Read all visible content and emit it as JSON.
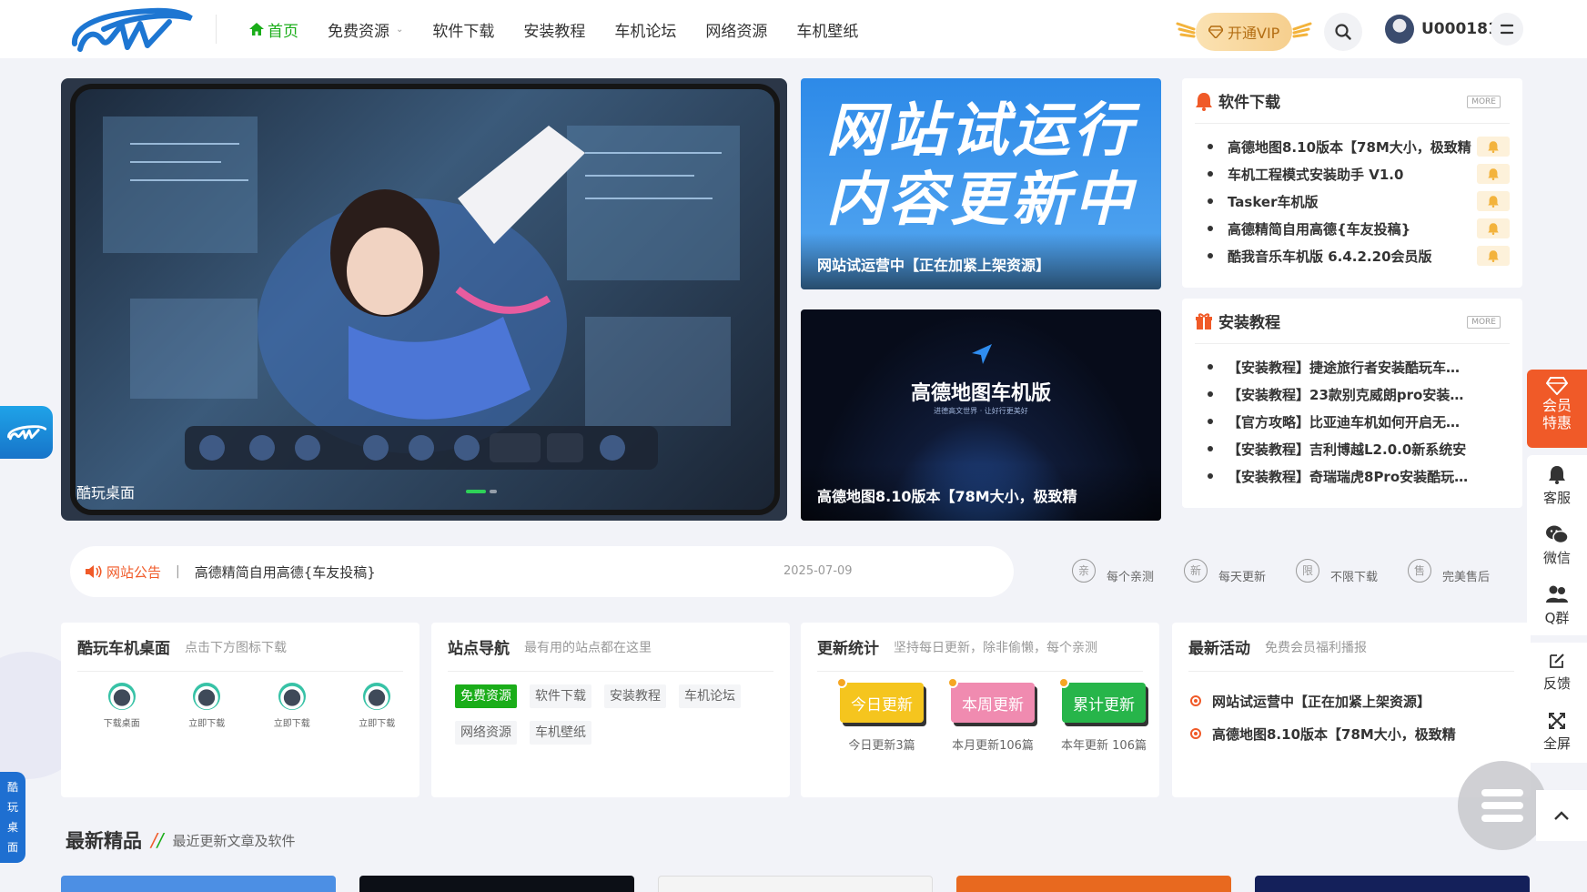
{
  "header": {
    "nav": [
      {
        "label": "首页",
        "active": true
      },
      {
        "label": "免费资源",
        "dropdown": true
      },
      {
        "label": "软件下载"
      },
      {
        "label": "安装教程"
      },
      {
        "label": "车机论坛"
      },
      {
        "label": "网络资源"
      },
      {
        "label": "车机壁纸"
      }
    ],
    "vip_label": "开通VIP",
    "username": "U000181"
  },
  "hero": {
    "caption": "酷玩桌面"
  },
  "cards": [
    {
      "big_lines": [
        "网站试运行",
        "内容更新中"
      ],
      "caption": "网站试运营中【正在加紧上架资源】"
    },
    {
      "title": "高德地图车机版",
      "subtitle": "进德高文世界 · 让好行更美好",
      "caption": "高德地图8.10版本【78M大小，极致精"
    }
  ],
  "software": {
    "title": "软件下载",
    "more": "MORE",
    "items": [
      "高德地图8.10版本【78M大小，极致精",
      "车机工程模式安装助手 V1.0",
      "Tasker车机版",
      "高德精简自用高德{车友投稿}",
      "酷我音乐车机版 6.4.2.20会员版"
    ]
  },
  "tutorials": {
    "title": "安装教程",
    "more": "MORE",
    "items": [
      "【安装教程】捷途旅行者安装酷玩车…",
      "【安装教程】23款别克威朗pro安装…",
      "【官方攻略】比亚迪车机如何开启无…",
      "【安装教程】吉利博越L2.0.0新系统安",
      "【安装教程】奇瑞瑞虎8Pro安装酷玩…"
    ]
  },
  "notice": {
    "label": "网站公告",
    "sep": "|",
    "message": "高德精简自用高德{车友投稿}",
    "date": "2025-07-09"
  },
  "features": [
    {
      "badge": "亲",
      "text": "每个亲测"
    },
    {
      "badge": "新",
      "text": "每天更新"
    },
    {
      "badge": "限",
      "text": "不限下载"
    },
    {
      "badge": "售",
      "text": "完美售后"
    }
  ],
  "desktop_card": {
    "title": "酷玩车机桌面",
    "hint": "点击下方图标下载",
    "items": [
      "下载桌面",
      "立即下载",
      "立即下载",
      "立即下载"
    ]
  },
  "nav_card": {
    "title": "站点导航",
    "hint": "最有用的站点都在这里",
    "tags": [
      "免费资源",
      "软件下载",
      "安装教程",
      "车机论坛",
      "网络资源",
      "车机壁纸"
    ]
  },
  "stats_card": {
    "title": "更新统计",
    "hint": "坚持每日更新，除非偷懒，每个亲测",
    "items": [
      {
        "label": "今日更新",
        "caption": "今日更新3篇",
        "color": "#f5c51e"
      },
      {
        "label": "本周更新",
        "caption": "本月更新106篇",
        "color": "#f08bb0"
      },
      {
        "label": "累计更新",
        "caption": "本年更新 106篇",
        "color": "#27b54a"
      }
    ]
  },
  "activity_card": {
    "title": "最新活动",
    "hint": "免费会员福利播报",
    "items": [
      "网站试运营中【正在加紧上架资源】",
      "高德地图8.10版本【78M大小，极致精"
    ]
  },
  "section": {
    "title": "最新精品",
    "slash": "//",
    "subtitle": "最近更新文章及软件"
  },
  "right_bar": {
    "vip": [
      "会员",
      "特惠"
    ],
    "group1": [
      "客服",
      "微信",
      "Q群"
    ],
    "group2": [
      "反馈",
      "全屏"
    ]
  },
  "left_vertical": [
    "酷",
    "玩",
    "桌",
    "面"
  ],
  "colors": {
    "accent_green": "#1aad19",
    "accent_orange": "#f05a28",
    "vip_gold": "#f6cf8e"
  }
}
